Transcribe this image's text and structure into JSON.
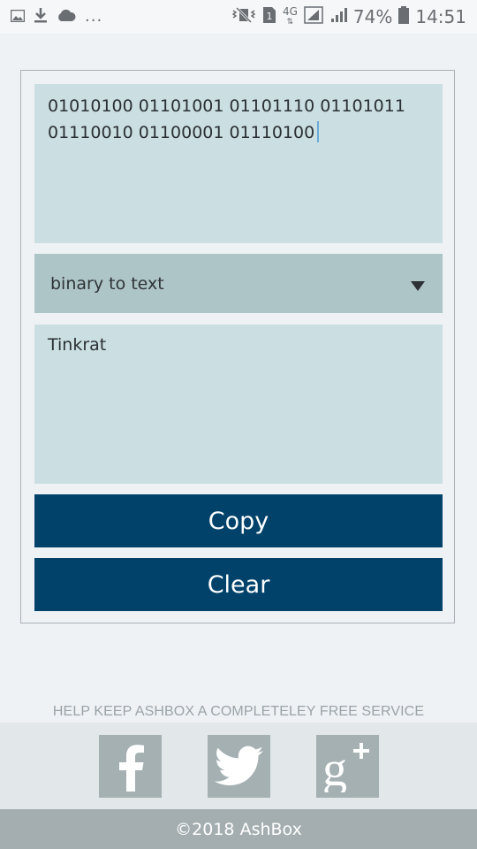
{
  "status_bar": {
    "overflow": "...",
    "network": "4G",
    "battery": "74%",
    "time": "14:51",
    "left_icons": [
      "image-icon",
      "download-icon",
      "cloud-icon"
    ],
    "right_icons": [
      "vibrate-icon",
      "sim-icon",
      "signal-icon",
      "battery-icon"
    ]
  },
  "converter": {
    "input_text": "01010100 01101001 01101110 01101011 01110010 01100001 01110100",
    "mode": "binary to text",
    "output_text": "Tinkrat",
    "copy_label": "Copy",
    "clear_label": "Clear"
  },
  "footer": {
    "help_text": "HELP KEEP ASHBOX A COMPLETELEY FREE SERVICE",
    "social": [
      "facebook-icon",
      "twitter-icon",
      "google-plus-icon"
    ],
    "copyright": "©2018 AshBox"
  },
  "colors": {
    "primary_button": "#00426a",
    "input_bg": "#cbdfe2",
    "select_bg": "#aec5c7",
    "social_icon_bg": "#a5b0b2"
  }
}
